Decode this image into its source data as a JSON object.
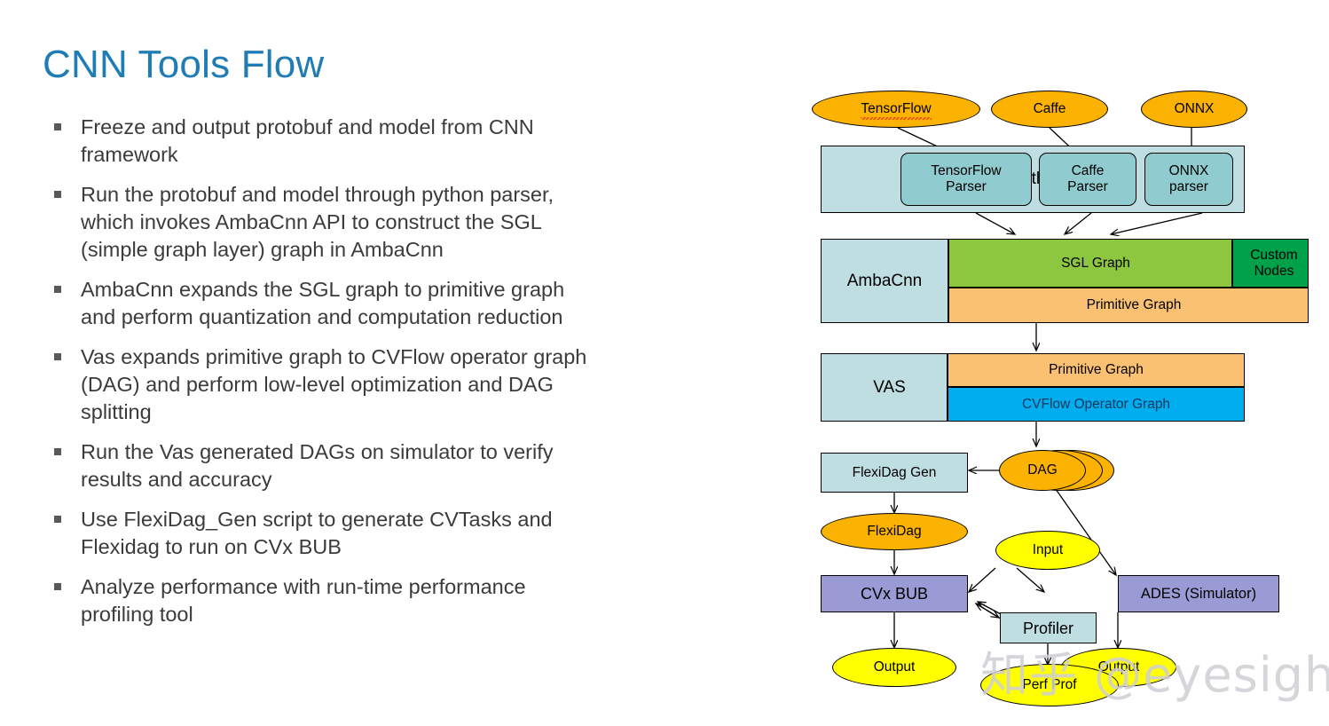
{
  "slide": {
    "title": "CNN Tools Flow",
    "title_color": "#1f7cb4",
    "bullets": [
      "Freeze and output protobuf and model from CNN\nframework",
      "Run the protobuf and model through python parser,\nwhich invokes AmbaCnn API to construct the SGL\n(simple graph layer) graph in AmbaCnn",
      "AmbaCnn expands the SGL graph to primitive graph\nand perform quantization and computation reduction",
      "Vas expands primitive graph to CVFlow operator graph\n(DAG) and perform low-level optimization and DAG\nsplitting",
      "Run the Vas generated DAGs on simulator to verify\nresults and accuracy",
      "Use FlexiDag_Gen script to generate CVTasks and\nFlexidag to run on CVx BUB",
      "Analyze performance with run-time performance\nprofiling tool"
    ]
  },
  "diagram": {
    "frameworks": {
      "tensorflow": "TensorFlow",
      "caffe": "Caffe",
      "onnx": "ONNX"
    },
    "python_layer": {
      "label": "Python",
      "parsers": {
        "tensorflow": "TensorFlow\nParser",
        "caffe": "Caffe\nParser",
        "onnx": "ONNX\nparser"
      }
    },
    "ambacnn_layer": {
      "label": "AmbaCnn",
      "sgl_graph": "SGL Graph",
      "custom_nodes": "Custom\nNodes",
      "primitive_graph": "Primitive Graph"
    },
    "vas_layer": {
      "label": "VAS",
      "primitive_graph": "Primitive Graph",
      "cvflow_operator_graph": "CVFlow Operator Graph"
    },
    "backend": {
      "dag": "DAG",
      "flexidag_gen": "FlexiDag Gen",
      "flexidag": "FlexiDag",
      "input": "Input",
      "cvx_bub": "CVx BUB",
      "ades": "ADES (Simulator)",
      "profiler": "Profiler",
      "output_left": "Output",
      "output_right": "Output",
      "perf_prof": "Perf Prof"
    },
    "colors": {
      "orange": "#FBB200",
      "yellow": "#FFFF00",
      "light_blue": "#BFDEE2",
      "teal": "#8FCBCF",
      "green": "#8DC63F",
      "dark_green": "#00A14B",
      "peach": "#FBC173",
      "cyan": "#00AEEF",
      "purple": "#9A9AD4"
    }
  },
  "watermark": {
    "text": "知乎 @eyesighting"
  }
}
